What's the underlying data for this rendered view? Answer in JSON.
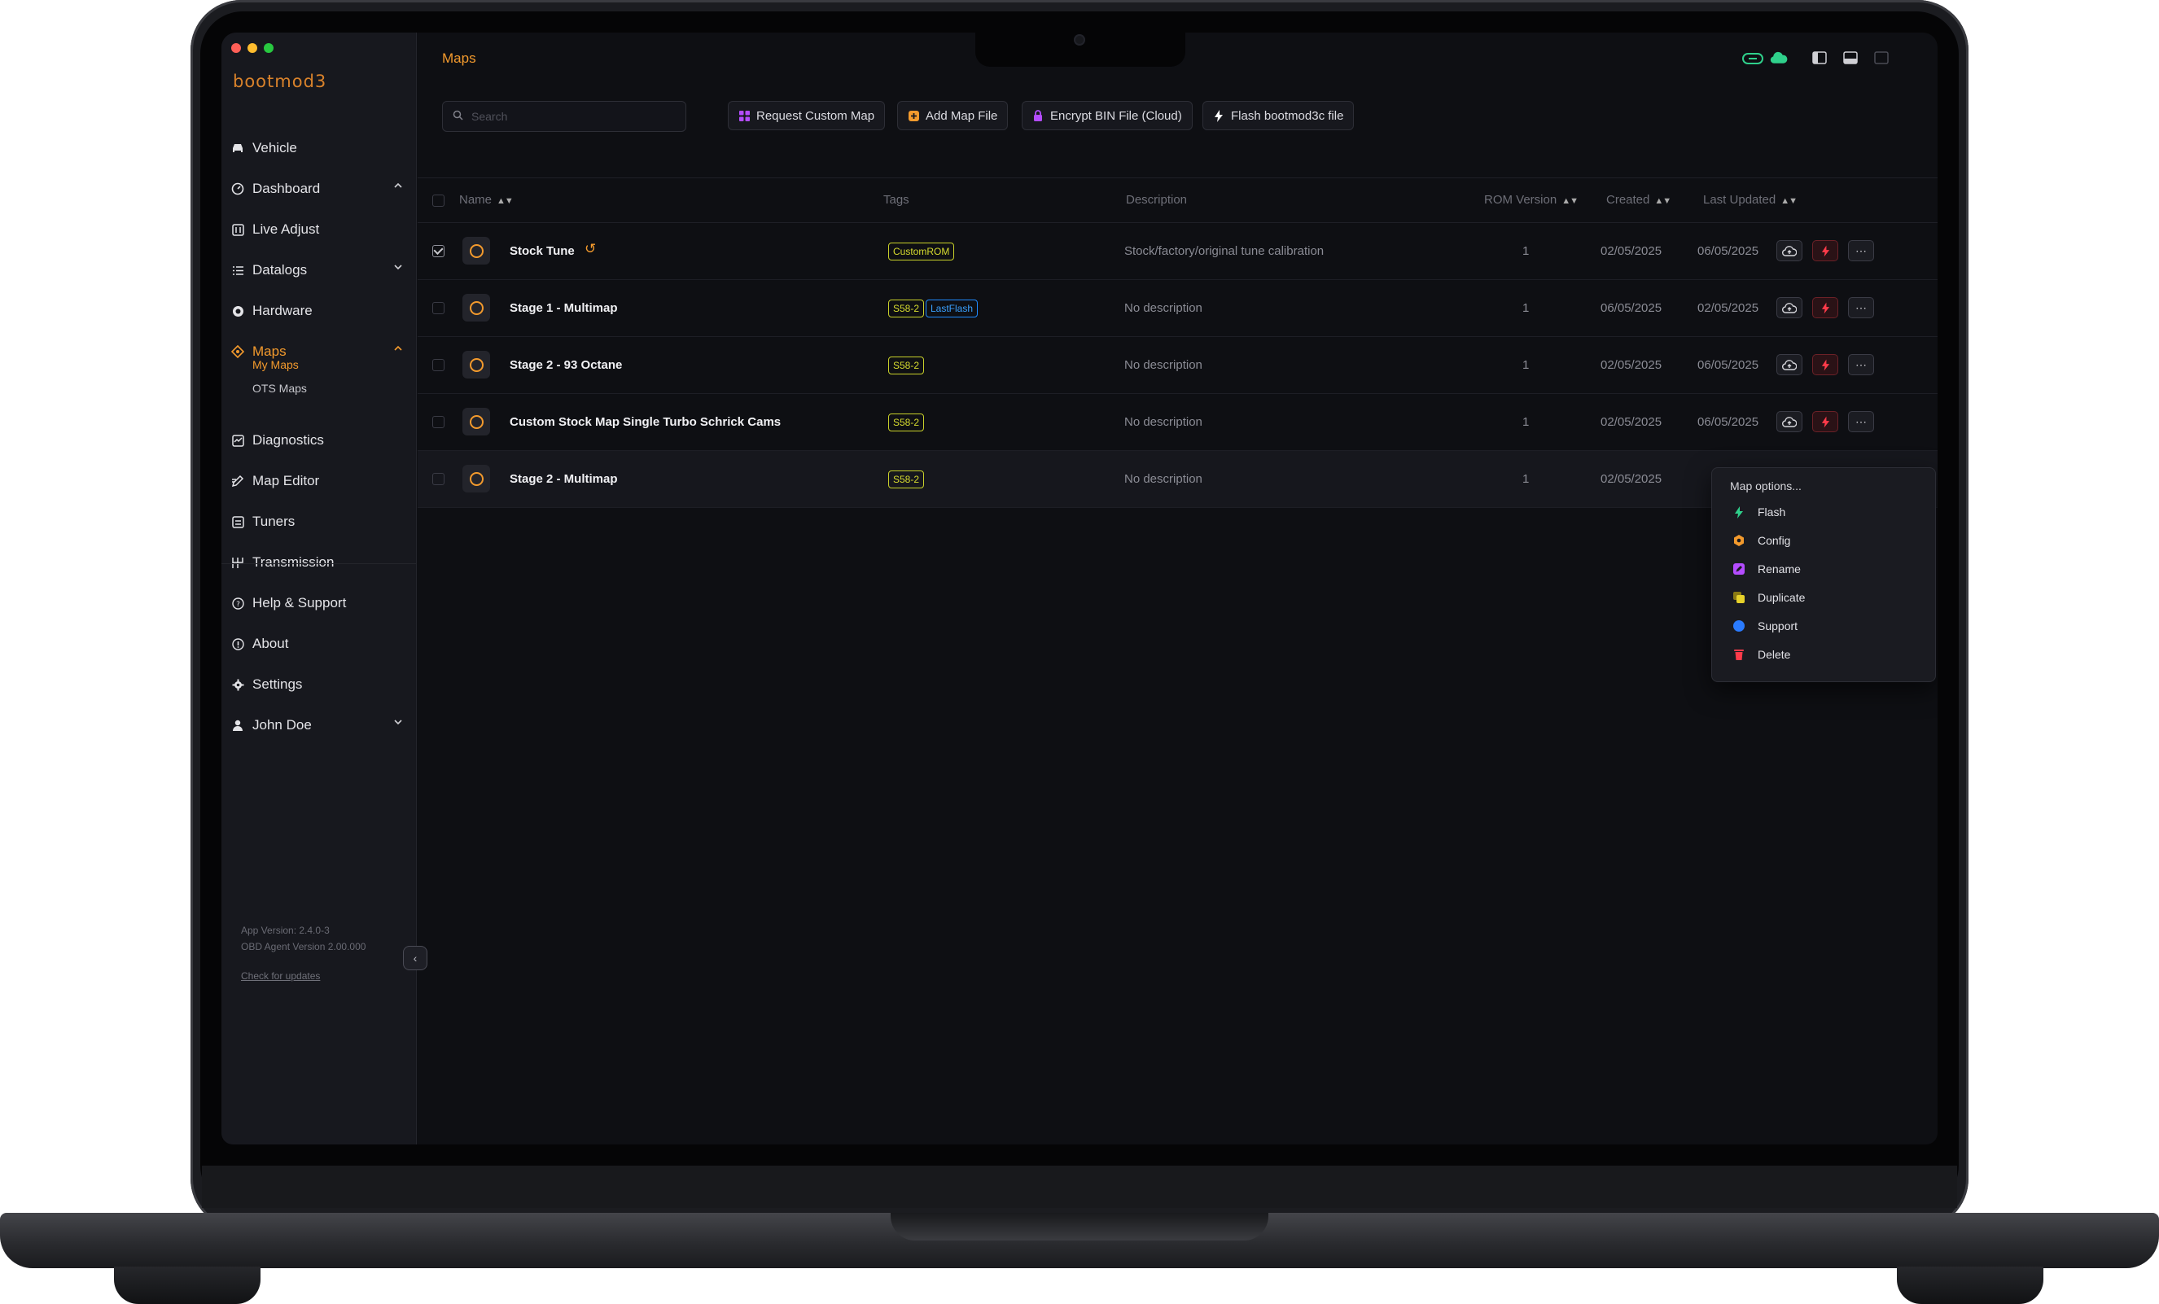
{
  "app": {
    "brand": "bootmod3",
    "page_title": "Maps",
    "accent": "#f39a2d"
  },
  "sidebar": {
    "items": [
      {
        "label": "Vehicle",
        "icon": "car-icon"
      },
      {
        "label": "Dashboard",
        "icon": "gauge-icon",
        "chevron": "up"
      },
      {
        "label": "Live Adjust",
        "icon": "sliders-icon"
      },
      {
        "label": "Datalogs",
        "icon": "list-icon",
        "chevron": "down"
      },
      {
        "label": "Hardware",
        "icon": "chip-icon"
      },
      {
        "label": "Maps",
        "icon": "map-icon",
        "chevron": "up",
        "active": true
      },
      {
        "label": "Diagnostics",
        "icon": "diagnostics-icon"
      },
      {
        "label": "Map Editor",
        "icon": "edit-icon"
      },
      {
        "label": "Tuners",
        "icon": "tuners-icon"
      },
      {
        "label": "Transmission",
        "icon": "gearbox-icon"
      },
      {
        "label": "Help & Support",
        "icon": "help-icon"
      },
      {
        "label": "About",
        "icon": "info-icon"
      },
      {
        "label": "Settings",
        "icon": "gear-icon"
      },
      {
        "label": "John Doe",
        "icon": "user-icon",
        "chevron": "down"
      }
    ],
    "sub_items": [
      {
        "label": "My Maps",
        "active": true
      },
      {
        "label": "OTS Maps"
      }
    ],
    "app_version": "App Version: 2.4.0-3",
    "obd_version": "OBD Agent Version 2.00.000",
    "check_updates": "Check for updates"
  },
  "toolbar": {
    "search_placeholder": "Search",
    "buttons": [
      {
        "label": "Request Custom Map",
        "icon": "grid-icon",
        "color": "#b44cff"
      },
      {
        "label": "Add Map File",
        "icon": "plus-square-icon",
        "color": "#f39a2d"
      },
      {
        "label": "Encrypt BIN File (Cloud)",
        "icon": "lock-icon",
        "color": "#b44cff"
      },
      {
        "label": "Flash bootmod3c file",
        "icon": "bolt-icon",
        "color": "#ffffff"
      }
    ]
  },
  "table": {
    "columns": {
      "name": "Name",
      "tags": "Tags",
      "description": "Description",
      "rom": "ROM Version",
      "created": "Created",
      "updated": "Last Updated"
    },
    "rows": [
      {
        "name": "Stock Tune",
        "tags": [
          {
            "text": "CustomROM",
            "color": "yellow"
          }
        ],
        "description": "Stock/factory/original tune calibration",
        "rom": "1",
        "created": "02/05/2025",
        "updated": "06/05/2025",
        "checked": true,
        "history": true
      },
      {
        "name": "Stage 1 - Multimap",
        "tags": [
          {
            "text": "S58-2",
            "color": "yellow"
          },
          {
            "text": "LastFlash",
            "color": "blue"
          }
        ],
        "description": "No description",
        "rom": "1",
        "created": "06/05/2025",
        "updated": "02/05/2025"
      },
      {
        "name": "Stage 2 - 93 Octane",
        "tags": [
          {
            "text": "S58-2",
            "color": "yellow"
          }
        ],
        "description": "No description",
        "rom": "1",
        "created": "02/05/2025",
        "updated": "06/05/2025"
      },
      {
        "name": "Custom Stock Map Single Turbo Schrick Cams",
        "tags": [
          {
            "text": "S58-2",
            "color": "yellow"
          }
        ],
        "description": "No description",
        "rom": "1",
        "created": "02/05/2025",
        "updated": "06/05/2025"
      },
      {
        "name": "Stage 2 - Multimap",
        "tags": [
          {
            "text": "S58-2",
            "color": "yellow"
          }
        ],
        "description": "No description",
        "rom": "1",
        "created": "02/05/2025",
        "updated": ""
      }
    ]
  },
  "menu": {
    "title": "Map options...",
    "items": [
      {
        "label": "Flash",
        "icon": "bolt-icon",
        "color": "#2fd08b"
      },
      {
        "label": "Config",
        "icon": "config-icon",
        "color": "#f39a2d"
      },
      {
        "label": "Rename",
        "icon": "pencil-icon",
        "color": "#b44cff"
      },
      {
        "label": "Duplicate",
        "icon": "copy-icon",
        "color": "#e6d12a"
      },
      {
        "label": "Support",
        "icon": "support-icon",
        "color": "#2a7bff"
      },
      {
        "label": "Delete",
        "icon": "trash-icon",
        "color": "#ff3b4a"
      }
    ]
  }
}
